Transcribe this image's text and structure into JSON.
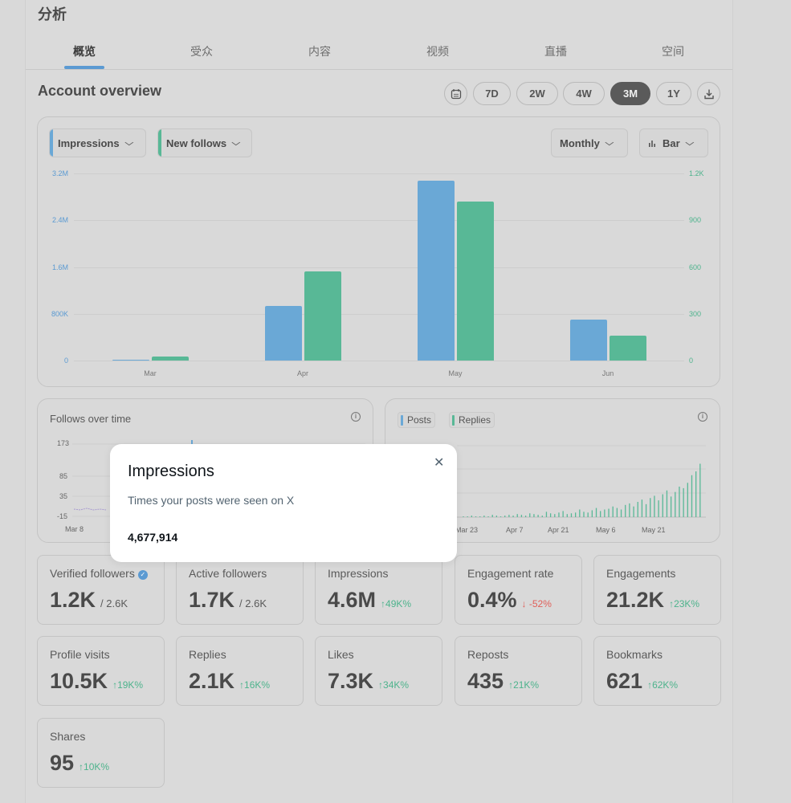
{
  "page": {
    "title": "分析"
  },
  "tabs": [
    {
      "label": "概览",
      "active": true
    },
    {
      "label": "受众",
      "active": false
    },
    {
      "label": "内容",
      "active": false
    },
    {
      "label": "视频",
      "active": false
    },
    {
      "label": "直播",
      "active": false
    },
    {
      "label": "空间",
      "active": false
    }
  ],
  "overview": {
    "title": "Account overview",
    "calendar_icon": "calendar-icon",
    "download_icon": "download-icon",
    "ranges": [
      {
        "label": "7D",
        "active": false
      },
      {
        "label": "2W",
        "active": false
      },
      {
        "label": "4W",
        "active": false
      },
      {
        "label": "3M",
        "active": true
      },
      {
        "label": "1Y",
        "active": false
      }
    ]
  },
  "main_chart": {
    "metric1": "Impressions",
    "metric2": "New follows",
    "period": "Monthly",
    "chart_type_label": "Bar",
    "chart_type_icon": "bar-chart-icon",
    "colors": {
      "metric1": "#6aa8d6",
      "metric2": "#58b896"
    }
  },
  "follows_over_time": {
    "title": "Follows over time",
    "y_ticks": [
      "173",
      "85",
      "35",
      "-15"
    ],
    "x_first": "Mar 8",
    "info_icon": "info-icon"
  },
  "posts_replies": {
    "chip1": "Posts",
    "chip2": "Replies",
    "x_ticks": [
      "Mar 23",
      "Apr 7",
      "Apr 21",
      "May 6",
      "May 21"
    ],
    "info_icon": "info-icon"
  },
  "tooltip": {
    "title": "Impressions",
    "description": "Times your posts were seen on X",
    "value": "4,677,914",
    "close_icon": "close-icon"
  },
  "stats": {
    "verified_followers": {
      "label": "Verified followers",
      "value": "1.2K",
      "total": "/ 2.6K",
      "badge_icon": "verified-badge-icon"
    },
    "active_followers": {
      "label": "Active followers",
      "value": "1.7K",
      "total": "/ 2.6K"
    },
    "impressions": {
      "label": "Impressions",
      "value": "4.6M",
      "change": "↑49K%"
    },
    "engagement_rate": {
      "label": "Engagement rate",
      "value": "0.4%",
      "change": "↓ -52%"
    },
    "engagements": {
      "label": "Engagements",
      "value": "21.2K",
      "change": "↑23K%"
    },
    "profile_visits": {
      "label": "Profile visits",
      "value": "10.5K",
      "change": "↑19K%"
    },
    "replies": {
      "label": "Replies",
      "value": "2.1K",
      "change": "↑16K%"
    },
    "likes": {
      "label": "Likes",
      "value": "7.3K",
      "change": "↑34K%"
    },
    "reposts": {
      "label": "Reposts",
      "value": "435",
      "change": "↑21K%"
    },
    "bookmarks": {
      "label": "Bookmarks",
      "value": "621",
      "change": "↑62K%"
    },
    "shares": {
      "label": "Shares",
      "value": "95",
      "change": "↑10K%"
    }
  },
  "chart_data": [
    {
      "type": "bar",
      "categories": [
        "Mar",
        "Apr",
        "May",
        "Jun"
      ],
      "series": [
        {
          "name": "Impressions",
          "axis": "left",
          "values": [
            20000,
            930000,
            3080000,
            700000
          ]
        },
        {
          "name": "New follows",
          "axis": "right",
          "values": [
            25,
            570,
            1020,
            160
          ]
        }
      ],
      "y_left_ticks": [
        "0",
        "800K",
        "1.6M",
        "2.4M",
        "3.2M"
      ],
      "y_right_ticks": [
        "0",
        "300",
        "600",
        "900",
        "1.2K"
      ],
      "ylim_left": [
        0,
        3200000
      ],
      "ylim_right": [
        0,
        1200
      ],
      "grid": true
    }
  ]
}
